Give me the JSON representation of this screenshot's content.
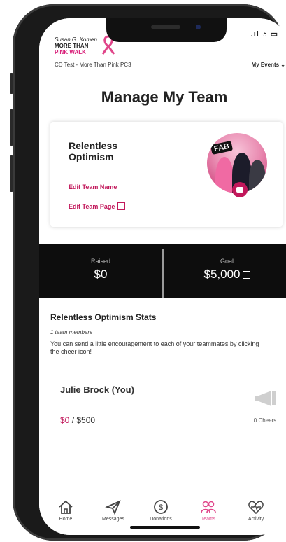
{
  "header": {
    "brand_line1": "Susan G. Komen",
    "brand_line2": "MORE THAN",
    "brand_line3": "PINK WALK",
    "event_name": "CD Test - More Than Pink PC3",
    "my_events_label": "My Events"
  },
  "page": {
    "title": "Manage My Team"
  },
  "team": {
    "name": "Relentless Optimism",
    "edit_name_label": "Edit Team Name",
    "edit_page_label": "Edit Team Page",
    "photo_badge": "FAB"
  },
  "stats": {
    "raised_label": "Raised",
    "raised_value": "$0",
    "goal_label": "Goal",
    "goal_value": "$5,000"
  },
  "team_stats": {
    "title": "Relentless Optimism Stats",
    "member_count": "1 team members",
    "description": "You can send a little encouragement to each of your teammates by clicking the cheer icon!",
    "members": [
      {
        "name": "Julie Brock (You)",
        "raised": "$0",
        "goal": " / $500",
        "cheers": "0 Cheers"
      }
    ]
  },
  "tabs": [
    {
      "label": "Home",
      "icon": "home-icon"
    },
    {
      "label": "Messages",
      "icon": "send-icon"
    },
    {
      "label": "Donations",
      "icon": "dollar-icon"
    },
    {
      "label": "Teams",
      "icon": "team-icon",
      "active": true
    },
    {
      "label": "Activity",
      "icon": "heart-pulse-icon"
    }
  ],
  "colors": {
    "accent": "#c2185b",
    "tab_active": "#e0468a",
    "band": "#0d0d0d"
  }
}
